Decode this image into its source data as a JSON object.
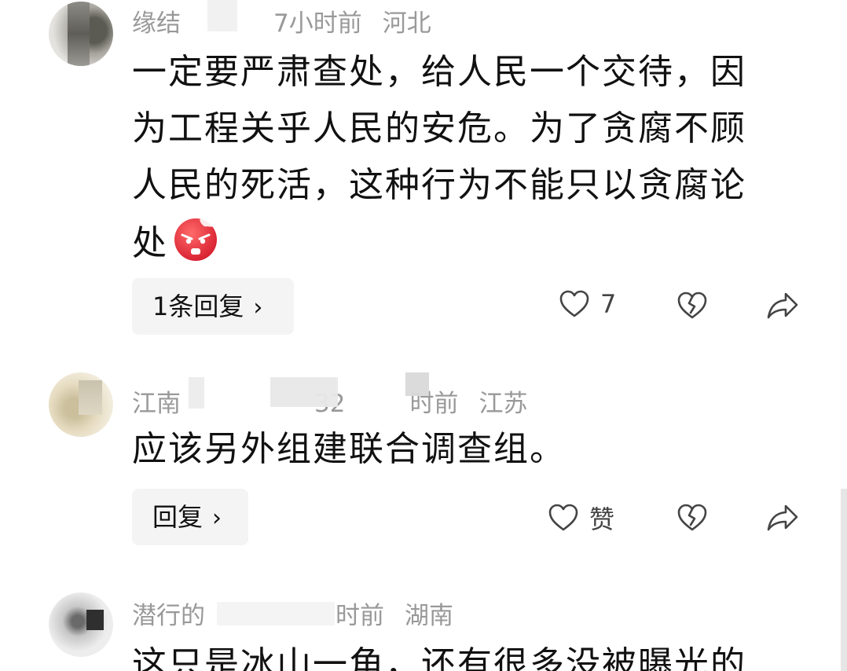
{
  "comments": [
    {
      "username": "缘结",
      "time": "7小时前",
      "location": "河北",
      "text": "一定要严肃查处，给人民一个交待，因为工程关乎人民的安危。为了贪腐不顾人民的死活，这种行为不能只以贪腐论处",
      "text_lines": [
        "一定要严肃查处，给人民一个交待，因",
        "为工程关乎人民的安危。为了贪腐不顾",
        "人民的死活，这种行为不能只以贪腐论",
        "处"
      ],
      "emoji": "angry-face-icon",
      "reply_label": "1条回复",
      "like_count": "7"
    },
    {
      "username": "江南",
      "time_partial": "32",
      "time": "时前",
      "location": "江苏",
      "text": "应该另外组建联合调查组。",
      "reply_label": "回复",
      "like_label": "赞"
    },
    {
      "username": "潜行的",
      "time": "时前",
      "location": "湖南",
      "text": "这只是冰山一角，还有很多没被曝光的"
    }
  ],
  "icons": {
    "like": "heart-icon",
    "dislike": "broken-heart-icon",
    "share": "share-arrow-icon",
    "chevron": "chevron-right-icon"
  },
  "colors": {
    "meta_text": "#999999",
    "body_text": "#111111",
    "reply_bg": "#f4f4f4",
    "emoji_red": "#e8283a"
  }
}
